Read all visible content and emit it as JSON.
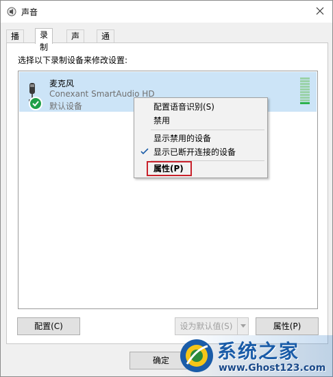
{
  "window": {
    "title": "声音"
  },
  "tabs": [
    {
      "label": "播放"
    },
    {
      "label": "录制"
    },
    {
      "label": "声音"
    },
    {
      "label": "通信"
    }
  ],
  "prompt": "选择以下录制设备来修改设置:",
  "device": {
    "name": "麦克风",
    "model": "Conexant SmartAudio HD",
    "status": "默认设备",
    "level_bars_total": 10,
    "level_bars_on": 1
  },
  "context_menu": {
    "items": [
      "配置语音识别(S)",
      "禁用",
      "显示禁用的设备",
      "显示已断开连接的设备",
      "属性(P)"
    ]
  },
  "buttons": {
    "configure": "配置(C)",
    "set_default": "设为默认值(S)",
    "properties": "属性(P)",
    "ok": "确定"
  },
  "watermark": {
    "title": "系统之家",
    "url": "www.Ghost123.com"
  },
  "colors": {
    "selection": "#cce4f7",
    "check_green": "#20a048",
    "highlight_red": "#c8202a"
  }
}
